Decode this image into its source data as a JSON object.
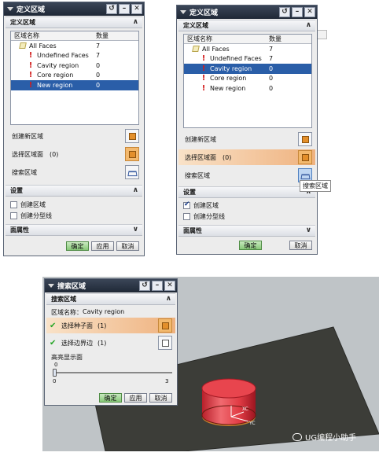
{
  "dialog1": {
    "title": "定义区域",
    "section_define": "定义区域",
    "list_headers": [
      "区域名称",
      "数量"
    ],
    "rows": [
      {
        "name": "All Faces",
        "count": "7",
        "icon": "face-icon",
        "selected": false
      },
      {
        "name": "Undefined Faces",
        "count": "7",
        "icon": "exclamation-icon",
        "selected": false
      },
      {
        "name": "Cavity region",
        "count": "0",
        "icon": "exclamation-icon",
        "selected": false
      },
      {
        "name": "Core region",
        "count": "0",
        "icon": "exclamation-icon",
        "selected": false
      },
      {
        "name": "New region",
        "count": "0",
        "icon": "exclamation-icon",
        "selected": true
      }
    ],
    "create_region": "创建新区域",
    "select_faces": "选择区域面",
    "select_faces_count": "(0)",
    "search_region": "搜索区域",
    "section_settings": "设置",
    "chk_create_region": "创建区域",
    "chk_create_parting": "创建分型线",
    "section_face_props": "面属性",
    "btn_ok": "确定",
    "btn_apply": "应用",
    "btn_cancel": "取消"
  },
  "dialog2": {
    "title": "定义区域",
    "section_define": "定义区域",
    "list_headers": [
      "区域名称",
      "数量"
    ],
    "rows": [
      {
        "name": "All Faces",
        "count": "7",
        "icon": "face-icon",
        "selected": false
      },
      {
        "name": "Undefined Faces",
        "count": "7",
        "icon": "exclamation-icon",
        "selected": false
      },
      {
        "name": "Cavity region",
        "count": "0",
        "icon": "exclamation-icon",
        "selected": true
      },
      {
        "name": "Core region",
        "count": "0",
        "icon": "exclamation-icon",
        "selected": false
      },
      {
        "name": "New region",
        "count": "0",
        "icon": "exclamation-icon",
        "selected": false
      }
    ],
    "create_region": "创建新区域",
    "select_faces": "选择区域面",
    "select_faces_count": "(0)",
    "search_region": "搜索区域",
    "tooltip": "搜索区域",
    "section_settings": "设置",
    "chk_create_region": "创建区域",
    "chk_create_parting": "创建分型线",
    "section_face_props": "面属性",
    "btn_ok": "确定",
    "btn_cancel": "取消"
  },
  "dialog3": {
    "title": "搜索区域",
    "section_search": "搜索区域",
    "region_name_label": "区域名称：",
    "region_name_value": "Cavity region",
    "select_seed": "选择种子面",
    "select_seed_count": "(1)",
    "select_boundary": "选择边界边",
    "select_boundary_count": "(1)",
    "highlight_label": "高亮显示面",
    "slider_min": "0",
    "slider_max": "3",
    "slider_current": "0",
    "slider_value": 0,
    "btn_ok": "确定",
    "btn_apply": "应用",
    "btn_cancel": "取消"
  },
  "viewport": {
    "axis_xc": "XC",
    "axis_yc": "YC",
    "watermark": "UG编程小助手"
  },
  "colors": {
    "selection": "#2a5ea8",
    "titlebar": "#283244",
    "highlight": "#efb27f",
    "cylinder": "#e03b44"
  }
}
